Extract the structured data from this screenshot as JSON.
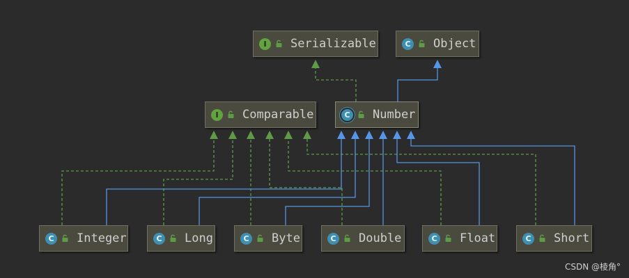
{
  "colors": {
    "background": "#2b2b2b",
    "node_fill": "#4a4a3f",
    "interface_edge": "#5f9a48",
    "class_edge": "#5596e6",
    "interface_badge": "#62a33f",
    "class_badge": "#3f8fb0"
  },
  "nodes": [
    {
      "id": "serializable",
      "label": "Serializable",
      "kind": "I"
    },
    {
      "id": "object",
      "label": "Object",
      "kind": "C"
    },
    {
      "id": "comparable",
      "label": "Comparable",
      "kind": "I"
    },
    {
      "id": "number",
      "label": "Number",
      "kind": "C"
    },
    {
      "id": "integer",
      "label": "Integer",
      "kind": "C"
    },
    {
      "id": "long",
      "label": "Long",
      "kind": "C"
    },
    {
      "id": "byte",
      "label": "Byte",
      "kind": "C"
    },
    {
      "id": "double",
      "label": "Double",
      "kind": "C"
    },
    {
      "id": "float",
      "label": "Float",
      "kind": "C"
    },
    {
      "id": "short",
      "label": "Short",
      "kind": "C"
    }
  ],
  "edges": [
    {
      "from": "number",
      "to": "serializable",
      "type": "implements"
    },
    {
      "from": "number",
      "to": "object",
      "type": "extends"
    },
    {
      "from": "integer",
      "to": "comparable",
      "type": "implements"
    },
    {
      "from": "long",
      "to": "comparable",
      "type": "implements"
    },
    {
      "from": "byte",
      "to": "comparable",
      "type": "implements"
    },
    {
      "from": "double",
      "to": "comparable",
      "type": "implements"
    },
    {
      "from": "float",
      "to": "comparable",
      "type": "implements"
    },
    {
      "from": "short",
      "to": "comparable",
      "type": "implements"
    },
    {
      "from": "integer",
      "to": "number",
      "type": "extends"
    },
    {
      "from": "long",
      "to": "number",
      "type": "extends"
    },
    {
      "from": "byte",
      "to": "number",
      "type": "extends"
    },
    {
      "from": "double",
      "to": "number",
      "type": "extends"
    },
    {
      "from": "float",
      "to": "number",
      "type": "extends"
    },
    {
      "from": "short",
      "to": "number",
      "type": "extends"
    }
  ],
  "watermark": "CSDN @棱角°"
}
